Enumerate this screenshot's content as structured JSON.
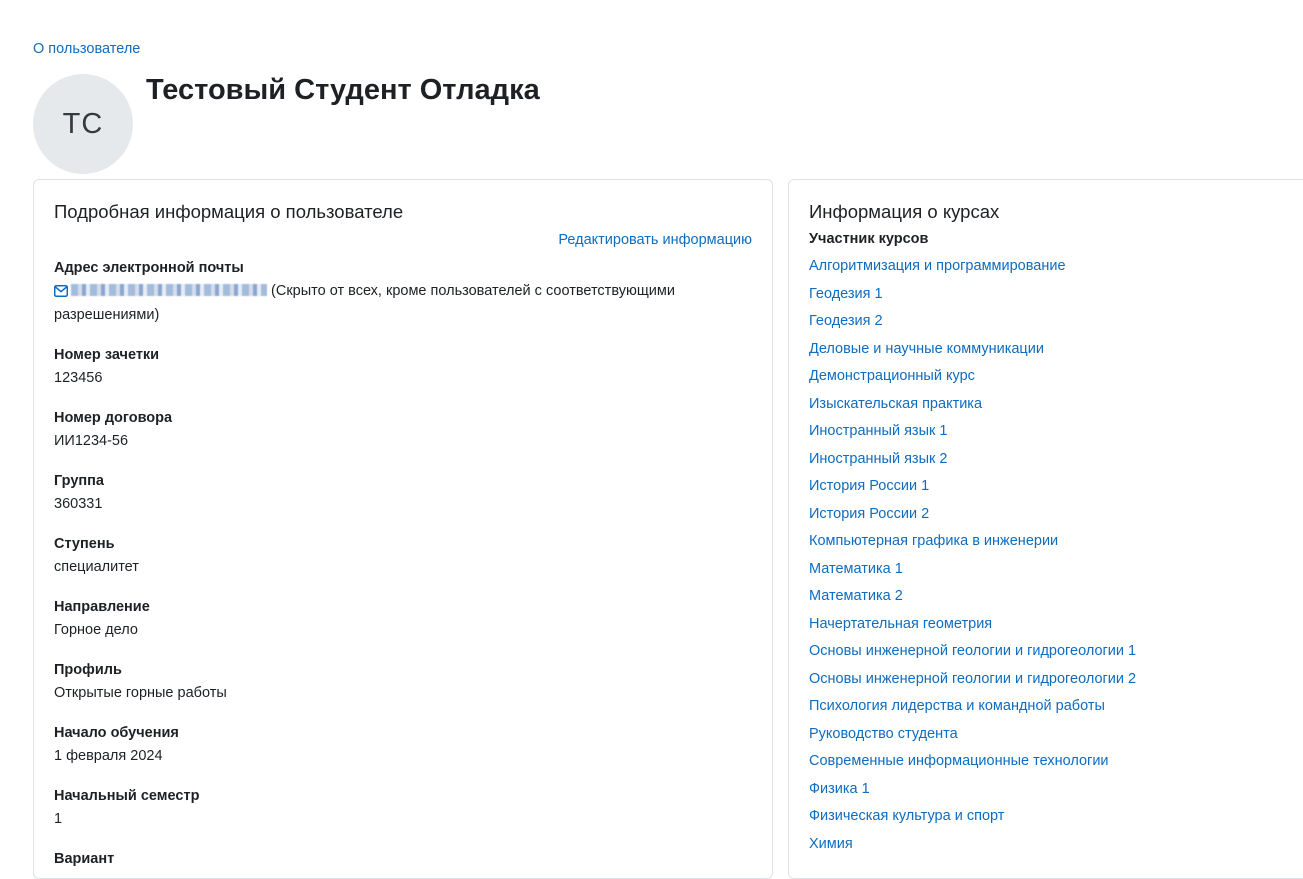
{
  "breadcrumb": {
    "label": "О пользователе"
  },
  "profile": {
    "initials": "ТС",
    "full_name": "Тестовый Студент Отладка"
  },
  "details": {
    "title": "Подробная информация о пользователе",
    "edit_label": "Редактировать информацию",
    "email": {
      "label": "Адрес электронной почты",
      "note": "(Скрыто от всех, кроме пользователей с соответствующими разрешениями)"
    },
    "fields": [
      {
        "label": "Номер зачетки",
        "value": "123456"
      },
      {
        "label": "Номер договора",
        "value": "ИИ1234-56"
      },
      {
        "label": "Группа",
        "value": "360331"
      },
      {
        "label": "Ступень",
        "value": "специалитет"
      },
      {
        "label": "Направление",
        "value": "Горное дело"
      },
      {
        "label": "Профиль",
        "value": "Открытые горные работы"
      },
      {
        "label": "Начало обучения",
        "value": "1 февраля 2024"
      },
      {
        "label": "Начальный семестр",
        "value": "1"
      },
      {
        "label": "Вариант",
        "value": ""
      }
    ]
  },
  "courses": {
    "title": "Информация о курсах",
    "subheading": "Участник курсов",
    "items": [
      "Алгоритмизация и программирование",
      "Геодезия 1",
      "Геодезия 2",
      "Деловые и научные коммуникации",
      "Демонстрационный курс",
      "Изыскательская практика",
      "Иностранный язык 1",
      "Иностранный язык 2",
      "История России 1",
      "История России 2",
      "Компьютерная графика в инженерии",
      "Математика 1",
      "Математика 2",
      "Начертательная геометрия",
      "Основы инженерной геологии и гидрогеологии 1",
      "Основы инженерной геологии и гидрогеологии 2",
      "Психология лидерства и командной работы",
      "Руководство студента",
      "Современные информационные технологии",
      "Физика 1",
      "Физическая культура и спорт",
      "Химия"
    ]
  },
  "colors": {
    "link": "#0f6cbf",
    "avatar_bg": "#e6e9ec",
    "border": "#dee2e6",
    "text": "#1d2125"
  }
}
